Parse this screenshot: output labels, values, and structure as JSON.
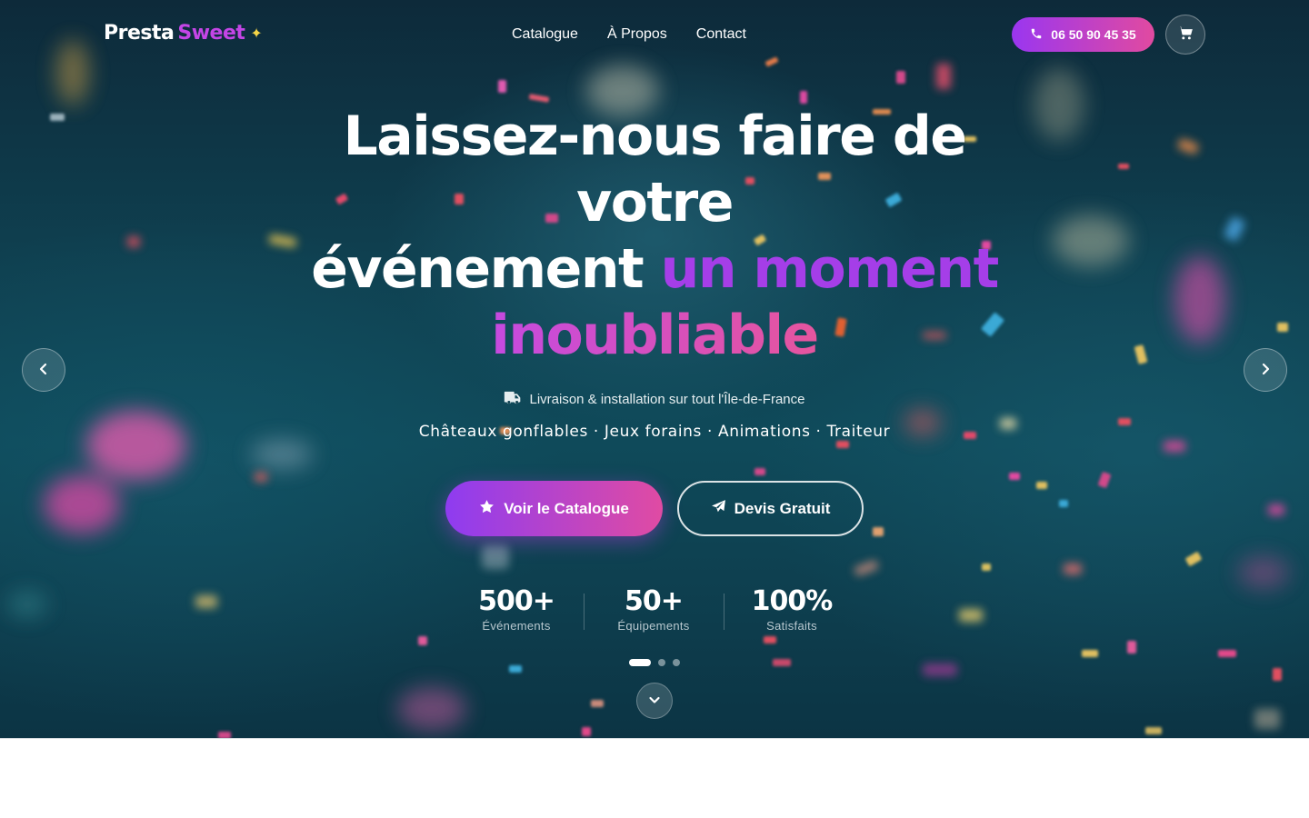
{
  "brand": {
    "name_part1": "Presta",
    "name_part2": "Sweet",
    "spark": "✦"
  },
  "nav": {
    "items": [
      {
        "label": "Catalogue"
      },
      {
        "label": "À Propos"
      },
      {
        "label": "Contact"
      }
    ]
  },
  "header": {
    "phone": "06 50 90 45 35",
    "phone_icon": "phone-icon",
    "cart_icon": "cart-icon"
  },
  "hero": {
    "headline_line1": "Laissez-nous faire de",
    "headline_line2": "votre",
    "headline_line3_white": "événement ",
    "headline_line3_accent": "un moment",
    "headline_line4_accent": "inoubliable",
    "delivery_text": "Livraison & installation sur tout l'Île-de-France",
    "delivery_icon": "truck-icon",
    "services_text": "Châteaux gonflables · Jeux forains · Animations · Traiteur",
    "primary_cta": "Voir le Catalogue",
    "primary_icon": "star-icon",
    "secondary_cta": "Devis Gratuit",
    "secondary_icon": "paper-plane-icon"
  },
  "stats": [
    {
      "value": "500+",
      "label": "Événements"
    },
    {
      "value": "50+",
      "label": "Équipements"
    },
    {
      "value": "100%",
      "label": "Satisfaits"
    }
  ],
  "carousel": {
    "slide_count": 3,
    "active_slide": 1,
    "prev_icon": "chevron-left-icon",
    "next_icon": "chevron-right-icon"
  },
  "scroll_icon": "chevron-down-icon",
  "colors": {
    "accent_purple": "#9a36f0",
    "accent_pink": "#e14aa0",
    "spark_yellow": "#f5d547",
    "hero_bg": "#0f4050"
  }
}
